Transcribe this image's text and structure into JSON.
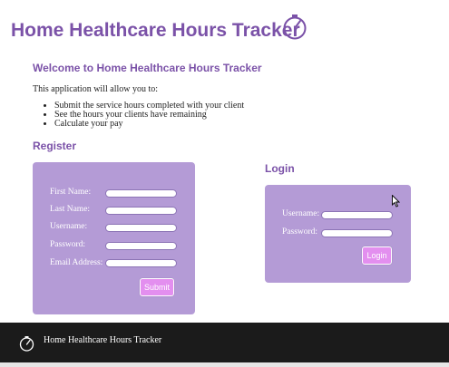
{
  "header": {
    "title": "Home Healthcare Hours Tracker",
    "logo_icon": "gauge-icon"
  },
  "welcome": {
    "heading": "Welcome to Home Healthcare Hours Tracker",
    "intro": "This application will allow you to:",
    "features": [
      "Submit the service hours completed with your client",
      "See the hours your clients have remaining",
      "Calculate your pay"
    ]
  },
  "register": {
    "heading": "Register",
    "fields": [
      {
        "label": "First Name:",
        "value": ""
      },
      {
        "label": "Last Name:",
        "value": ""
      },
      {
        "label": "Username:",
        "value": ""
      },
      {
        "label": "Password:",
        "value": ""
      },
      {
        "label": "Email Address:",
        "value": ""
      }
    ],
    "submit_label": "Submit"
  },
  "login": {
    "heading": "Login",
    "fields": [
      {
        "label": "Username:",
        "value": ""
      },
      {
        "label": "Password:",
        "value": ""
      }
    ],
    "login_label": "Login"
  },
  "footer": {
    "title": "Home Healthcare Hours Tracker",
    "logo_icon": "gauge-icon"
  },
  "colors": {
    "accent": "#7b52a8",
    "panel": "#b49bd6",
    "button": "#e38fef",
    "footer": "#1b1b1b"
  }
}
